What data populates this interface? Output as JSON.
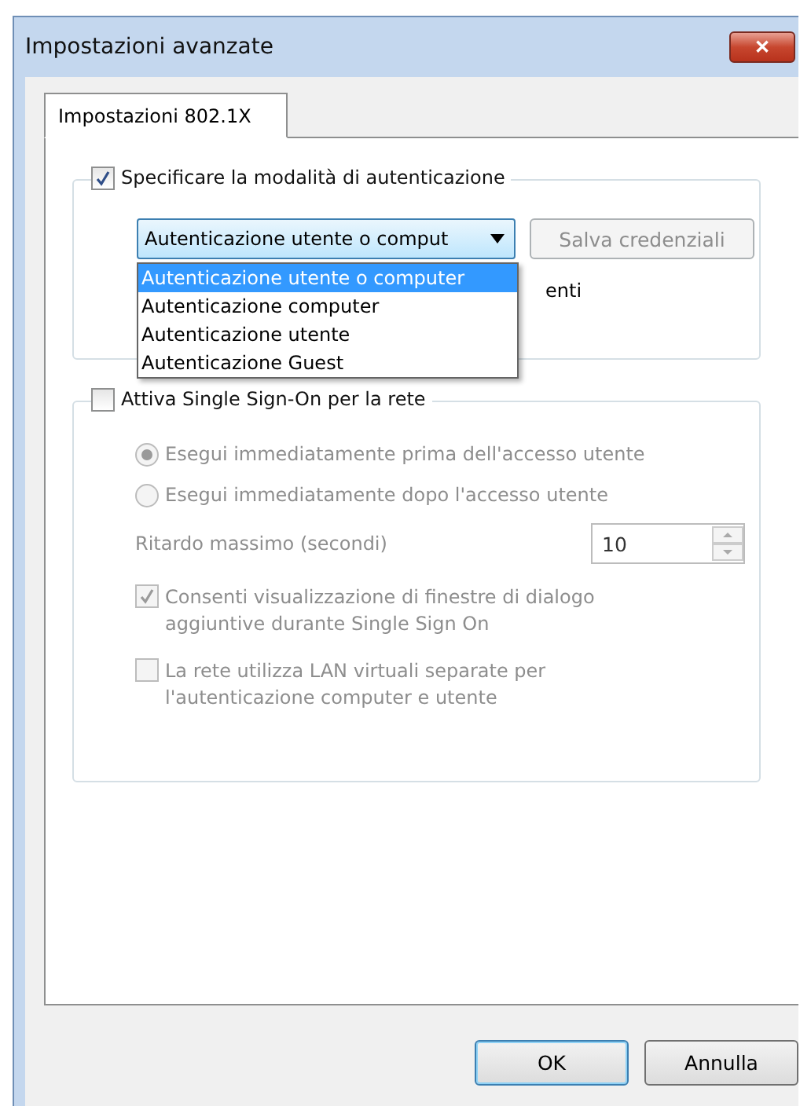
{
  "window": {
    "title": "Impostazioni avanzate",
    "close": "✕"
  },
  "tabs": [
    {
      "label": "Impostazioni 802.1X",
      "selected": true
    }
  ],
  "auth_group": {
    "checkbox": {
      "label": "Specificare la modalità di autenticazione",
      "checked": true,
      "disabled": false
    },
    "dropdown": {
      "visible_value": "Autenticazione utente o comput",
      "expanded": true,
      "options": [
        {
          "label": "Autenticazione utente o computer",
          "selected": true
        },
        {
          "label": "Autenticazione computer",
          "selected": false
        },
        {
          "label": "Autenticazione utente",
          "selected": false
        },
        {
          "label": "Autenticazione Guest",
          "selected": false
        }
      ]
    },
    "save_button": {
      "label": "Salva credenziali",
      "disabled": true
    },
    "hidden_label": "enti"
  },
  "sso_group": {
    "checkbox": {
      "label": "Attiva Single Sign-On per la rete",
      "checked": false,
      "disabled": false
    },
    "radios": [
      {
        "label": "Esegui immediatamente prima dell'accesso utente",
        "selected": true,
        "disabled": true
      },
      {
        "label": "Esegui immediatamente dopo l'accesso utente",
        "selected": false,
        "disabled": true
      }
    ],
    "delay": {
      "label": "Ritardo massimo (secondi)",
      "value": "10",
      "disabled": true
    },
    "options": [
      {
        "label": "Consenti visualizzazione di finestre di dialogo aggiuntive durante Single Sign On",
        "checked": true,
        "disabled": true
      },
      {
        "label": "La rete utilizza LAN virtuali separate per l'autenticazione computer e utente",
        "checked": false,
        "disabled": true
      }
    ]
  },
  "buttons": [
    {
      "label": "OK",
      "default": true
    },
    {
      "label": "Annulla",
      "default": false
    }
  ]
}
